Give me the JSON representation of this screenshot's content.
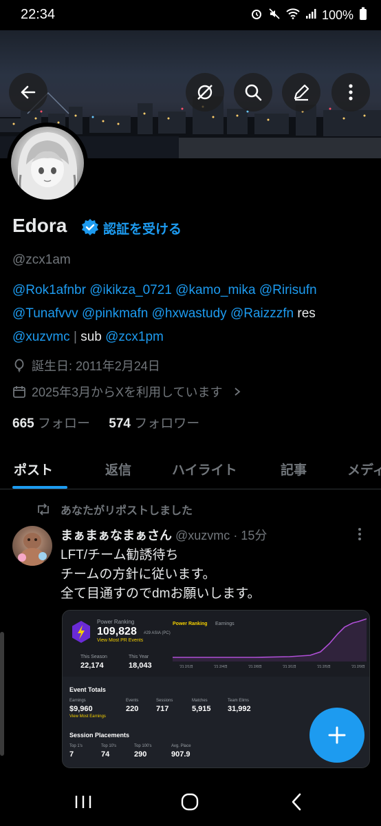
{
  "status_bar": {
    "time": "22:34",
    "battery": "100%",
    "icons": [
      "alarm-icon",
      "mute-icon",
      "wifi-icon",
      "signal-icon",
      "battery-icon"
    ]
  },
  "header": {
    "buttons": [
      "back-icon",
      "grok-icon",
      "search-icon",
      "compose-icon",
      "more-icon"
    ]
  },
  "profile": {
    "name": "Edora",
    "get_verified": "認証を受ける",
    "handle": "@zcx1am",
    "bio_line1": [
      "@Rok1afnbr",
      "@ikikza_0721",
      "@kamo_mika",
      "@Ririsufn"
    ],
    "bio_line2": [
      "@Tunafvvv",
      "@pinkmafn",
      "@hxwastudy",
      "@Raizzzfn"
    ],
    "bio_line2_suffix": "res",
    "bio_line3_mention1": "@xuzvmc",
    "bio_line3_sep": "|",
    "bio_line3_text": "sub",
    "bio_line3_mention2": "@zcx1pm",
    "birthday": "誕生日: 2011年2月24日",
    "joined": "2025年3月からXを利用しています",
    "following_count": "665",
    "following_label": "フォロー",
    "followers_count": "574",
    "followers_label": "フォロワー"
  },
  "tabs": [
    {
      "label": "ポスト",
      "active": true
    },
    {
      "label": "返信",
      "active": false
    },
    {
      "label": "ハイライト",
      "active": false
    },
    {
      "label": "記事",
      "active": false
    },
    {
      "label": "メディ",
      "active": false
    }
  ],
  "post": {
    "repost_label": "あなたがリポストしました",
    "author_name": "まぁまぁなまぁさん",
    "author_handle": "@xuzvmc",
    "time": "· 15分",
    "text": "LFT/チーム勧誘待ち\nチームの方針に従います。\n全て目通すのでdmお願いします。",
    "card": {
      "power_ranking_label": "Power Ranking",
      "power_ranking_value": "109,828",
      "region": "#29 ASIA (PC)",
      "view_most_pr": "View Most PR Events",
      "chart_tabs": [
        "Power Ranking",
        "Earnings"
      ],
      "chart_x_labels": [
        "'21 2/1日",
        "'21 2/4日",
        "'21 2/8日",
        "'21 3/1日",
        "'21 2/5日",
        "'21 2/9日"
      ],
      "this_season_label": "This Season",
      "this_season_value": "22,174",
      "this_year_label": "This Year",
      "this_year_value": "18,043",
      "event_totals_title": "Event Totals",
      "earnings_label": "Earnings",
      "earnings_value": "$9,960",
      "view_most_earnings": "View Most Earnings",
      "events_label": "Events",
      "events_value": "220",
      "sessions_label": "Sessions",
      "sessions_value": "717",
      "matches_label": "Matches",
      "matches_value": "5,915",
      "team_elims_label": "Team Elims",
      "team_elims_value": "31,992",
      "session_placements_title": "Session Placements",
      "top1_label": "Top 1's",
      "top1_value": "7",
      "top10_label": "Top 10's",
      "top10_value": "74",
      "top100_label": "Top 100's",
      "top100_value": "290",
      "avg_place_label": "Avg. Place",
      "avg_place_value": "907.9"
    }
  },
  "colors": {
    "accent": "#1d9bf0",
    "background": "#000000",
    "secondary_text": "#71767b",
    "chart_line": "#b04fd8"
  }
}
